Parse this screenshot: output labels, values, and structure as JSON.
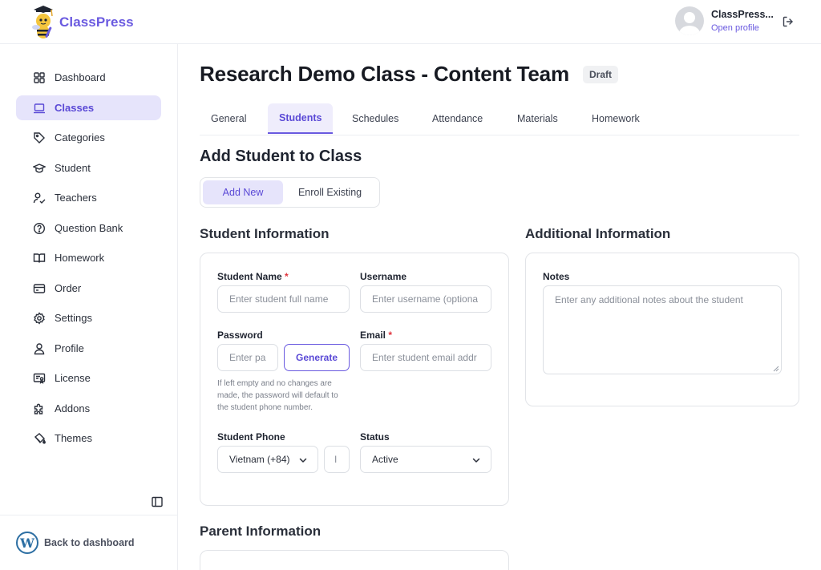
{
  "brand": {
    "name": "ClassPress",
    "accent": "#6a5ae0"
  },
  "user": {
    "name": "ClassPress...",
    "profile_link": "Open profile"
  },
  "sidebar": {
    "items": [
      {
        "label": "Dashboard",
        "icon": "grid-icon"
      },
      {
        "label": "Classes",
        "icon": "laptop-icon",
        "active": true
      },
      {
        "label": "Categories",
        "icon": "tag-icon"
      },
      {
        "label": "Student",
        "icon": "graduation-cap-icon"
      },
      {
        "label": "Teachers",
        "icon": "teacher-icon"
      },
      {
        "label": "Question Bank",
        "icon": "question-circle-icon"
      },
      {
        "label": "Homework",
        "icon": "book-open-icon"
      },
      {
        "label": "Order",
        "icon": "credit-card-icon"
      },
      {
        "label": "Settings",
        "icon": "gear-icon"
      },
      {
        "label": "Profile",
        "icon": "user-icon"
      },
      {
        "label": "License",
        "icon": "certificate-icon"
      },
      {
        "label": "Addons",
        "icon": "puzzle-icon"
      },
      {
        "label": "Themes",
        "icon": "paint-bucket-icon"
      }
    ],
    "back_label": "Back to dashboard"
  },
  "page": {
    "title": "Research Demo Class - Content Team",
    "status": "Draft",
    "tabs": [
      "General",
      "Students",
      "Schedules",
      "Attendance",
      "Materials",
      "Homework"
    ],
    "active_tab": "Students"
  },
  "form": {
    "heading": "Add Student to Class",
    "mode_tabs": {
      "add_new": "Add New",
      "enroll_existing": "Enroll Existing"
    },
    "student_info_title": "Student Information",
    "additional_info_title": "Additional Information",
    "parent_info_title": "Parent Information",
    "student_name": {
      "label": "Student Name",
      "required": "*",
      "placeholder": "Enter student full name"
    },
    "username": {
      "label": "Username",
      "placeholder": "Enter username (optiona"
    },
    "password": {
      "label": "Password",
      "placeholder": "Enter pa",
      "generate": "Generate",
      "help": "If left empty and no changes are made, the password will default to the student phone number."
    },
    "email": {
      "label": "Email",
      "required": "*",
      "placeholder": "Enter student email addr"
    },
    "phone": {
      "label": "Student Phone",
      "country": "Vietnam (+84)",
      "number_placeholder": "I"
    },
    "status": {
      "label": "Status",
      "value": "Active"
    },
    "notes": {
      "label": "Notes",
      "placeholder": "Enter any additional notes about the student"
    }
  }
}
